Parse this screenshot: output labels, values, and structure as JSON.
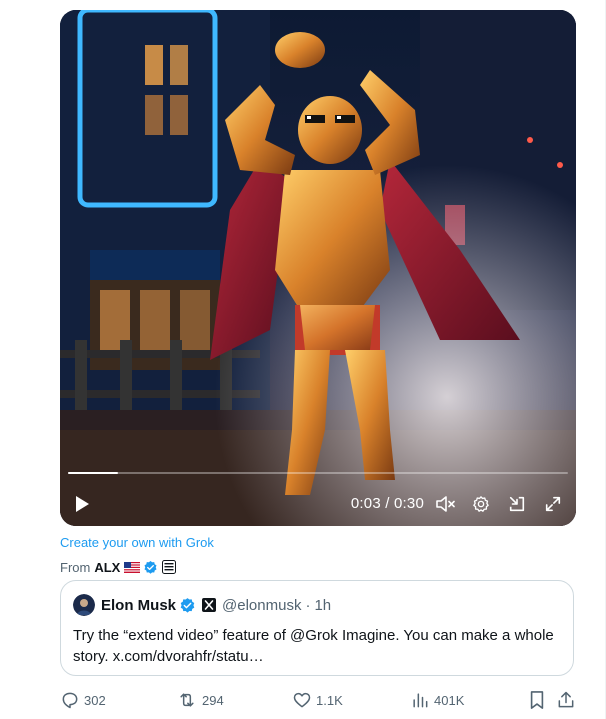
{
  "video": {
    "current_time": "0:03",
    "separator": " / ",
    "duration": "0:30",
    "progress": 0.1,
    "icons": {
      "play": "play-icon",
      "mute": "volume-muted-icon",
      "settings": "gear-icon",
      "dock": "dock-icon",
      "fullscreen": "fullscreen-icon"
    }
  },
  "grok_link": "Create your own with Grok",
  "from": {
    "prefix": "From",
    "handle": "ALX"
  },
  "quote": {
    "name": "Elon Musk",
    "handle": "@elonmusk",
    "dot": "·",
    "time": "1h",
    "text": "Try the “extend video” feature of @Grok Imagine. You can make a whole story. x.com/dvorahfr/statu…"
  },
  "actions": {
    "replies": "302",
    "reposts": "294",
    "likes": "1.1K",
    "views": "401K"
  },
  "colors": {
    "accent": "#1d9bf0",
    "secondary_text": "#536471",
    "border": "#cfd9de"
  }
}
